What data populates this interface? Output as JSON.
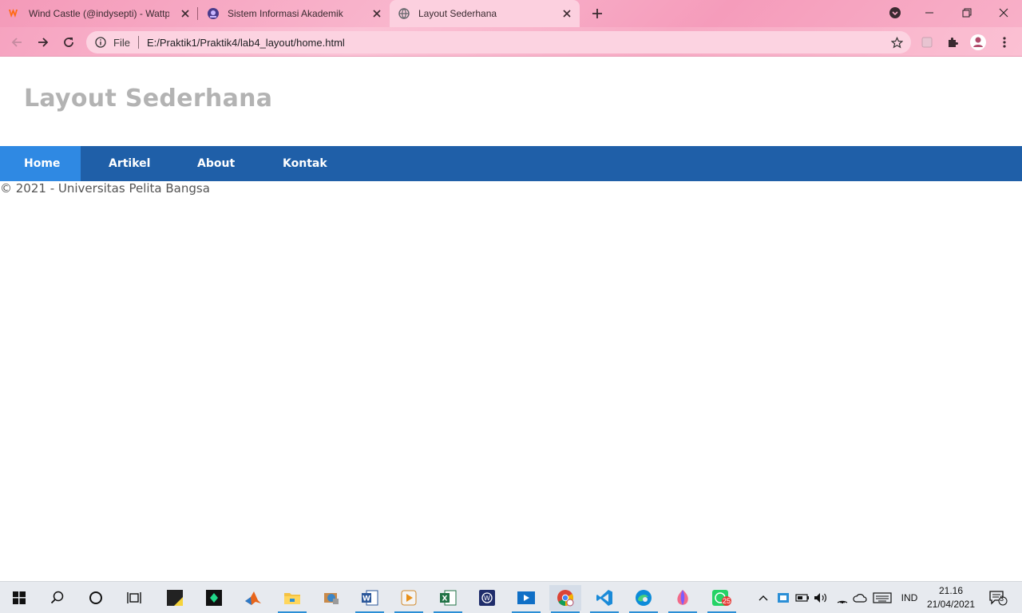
{
  "browser": {
    "tabs": [
      {
        "title": "Wind Castle (@indysepti) - Wattp",
        "icon": "wattpad-icon",
        "active": false
      },
      {
        "title": "Sistem Informasi Akademik",
        "icon": "academic-site-icon",
        "active": false
      },
      {
        "title": "Layout Sederhana",
        "icon": "globe-icon",
        "active": true
      }
    ],
    "omnibox": {
      "scheme_label": "File",
      "url": "E:/Praktik1/Praktik4/lab4_layout/home.html"
    }
  },
  "page": {
    "title": "Layout Sederhana",
    "nav": [
      {
        "label": "Home",
        "active": true
      },
      {
        "label": "Artikel",
        "active": false
      },
      {
        "label": "About",
        "active": false
      },
      {
        "label": "Kontak",
        "active": false
      }
    ],
    "footer": "© 2021 - Universitas Pelita Bangsa"
  },
  "taskbar": {
    "language": "IND",
    "time": "21.16",
    "date": "21/04/2021",
    "notification_count": "3",
    "whatsapp_badge": "25"
  },
  "colors": {
    "nav_bg": "#1f5fa8",
    "nav_active": "#2f89e3",
    "title_gray": "#b3b3b3",
    "chrome_pink": "#f7a9c4"
  }
}
